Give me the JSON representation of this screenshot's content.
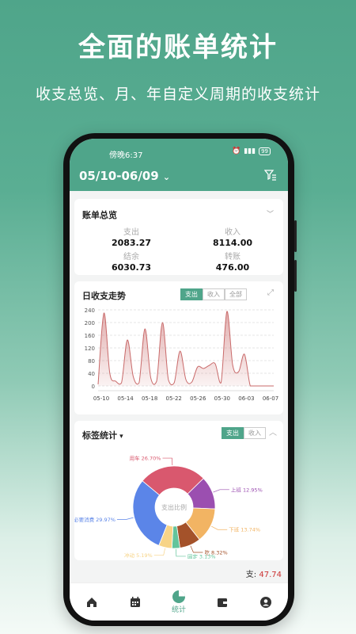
{
  "promo": {
    "title": "全面的账单统计",
    "subtitle": "收支总览、月、年自定义周期的收支统计"
  },
  "status_bar": {
    "time": "傍晚6:37",
    "battery": "99"
  },
  "header": {
    "date_range": "05/10-06/09",
    "chevron": "⌄"
  },
  "overview": {
    "title": "账单总览",
    "items": [
      {
        "label": "支出",
        "value": "2083.27"
      },
      {
        "label": "收入",
        "value": "8114.00"
      },
      {
        "label": "结余",
        "value": "6030.73"
      },
      {
        "label": "转账",
        "value": "476.00"
      }
    ]
  },
  "trend": {
    "title": "日收支走势",
    "tabs": [
      "支出",
      "收入",
      "全部"
    ],
    "active_tab": 0
  },
  "chart_data": {
    "type": "area",
    "x_tick_labels": [
      "05-10",
      "05-14",
      "05-18",
      "05-22",
      "05-26",
      "05-30",
      "06-03",
      "06-07"
    ],
    "y_ticks": [
      0,
      40,
      80,
      120,
      160,
      200,
      240
    ],
    "ylim": [
      0,
      240
    ],
    "series": [
      {
        "values": [
          5,
          230,
          40,
          15,
          10,
          145,
          30,
          10,
          180,
          25,
          15,
          200,
          20,
          10,
          110,
          20,
          12,
          60,
          55,
          65,
          70,
          10,
          235,
          65,
          45,
          100,
          0,
          0,
          0,
          0,
          0
        ]
      }
    ],
    "color": "#c96a6a"
  },
  "tags": {
    "title": "标签统计",
    "tabs": [
      "支出",
      "收入"
    ],
    "active_tab": 0,
    "center_label": "支出比例",
    "slices": [
      {
        "label": "用车 26.70%",
        "value": 26.7,
        "color": "#d9586e"
      },
      {
        "label": "上班 12.95%",
        "value": 12.95,
        "color": "#9b4fb0"
      },
      {
        "label": "下班 13.74%",
        "value": 13.74,
        "color": "#f2b463"
      },
      {
        "label": "吃 8.32%",
        "value": 8.32,
        "color": "#a4522a"
      },
      {
        "label": "固定 3.13%",
        "value": 3.13,
        "color": "#63c49b"
      },
      {
        "label": "冲动 5.19%",
        "value": 5.19,
        "color": "#f7d487"
      },
      {
        "label": "必要消费 29.97%",
        "value": 29.97,
        "color": "#5b85e8"
      }
    ],
    "peek_label": "支",
    "peek_value": "47.74"
  },
  "bottom_nav": {
    "items": [
      {
        "name": "home",
        "label": ""
      },
      {
        "name": "calendar",
        "label": ""
      },
      {
        "name": "stats",
        "label": "统计"
      },
      {
        "name": "wallet",
        "label": ""
      },
      {
        "name": "profile",
        "label": ""
      }
    ],
    "active": 2
  }
}
